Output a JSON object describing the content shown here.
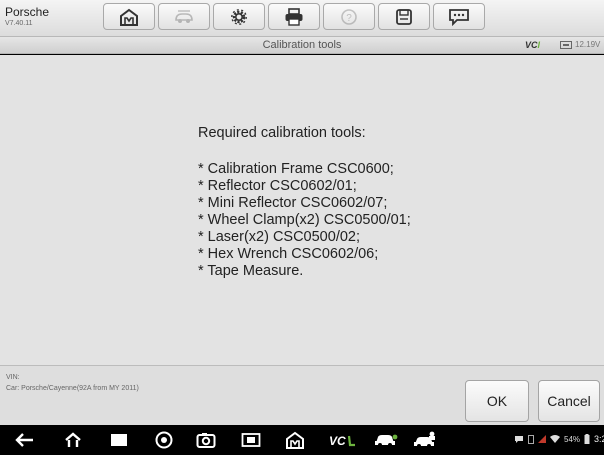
{
  "header": {
    "brand": "Porsche",
    "version": "V7.40.11"
  },
  "toolbar": {
    "buttons": [
      {
        "name": "home",
        "icon": "home-icon"
      },
      {
        "name": "vehicle-swap",
        "icon": "car-swap-icon"
      },
      {
        "name": "settings",
        "icon": "gear-icon"
      },
      {
        "name": "print",
        "icon": "printer-icon"
      },
      {
        "name": "help",
        "icon": "help-icon"
      },
      {
        "name": "save",
        "icon": "save-icon"
      },
      {
        "name": "data-logging",
        "icon": "chat-icon"
      }
    ]
  },
  "titlebar": {
    "title": "Calibration tools",
    "vci_label": "VCI",
    "voltage": "12.19V"
  },
  "message": {
    "heading": "Required calibration tools:",
    "items": [
      "* Calibration Frame CSC0600;",
      "* Reflector CSC0602/01;",
      "* Mini Reflector CSC0602/07;",
      "* Wheel Clamp(x2) CSC0500/01;",
      "* Laser(x2) CSC0500/02;",
      "* Hex Wrench CSC0602/06;",
      "* Tape Measure."
    ]
  },
  "footer": {
    "vin_label": "VIN:",
    "car_info": "Car: Porsche/Cayenne(92A from MY 2011)",
    "ok_label": "OK",
    "cancel_label": "Cancel"
  },
  "navbar": {
    "icons": [
      "back-icon",
      "home-icon",
      "recents-icon",
      "browser-icon",
      "camera-icon",
      "screenshot-icon",
      "app-home-icon",
      "vci-icon",
      "car-icon",
      "car-repair-icon"
    ],
    "battery_text": "54%",
    "time": "3:2"
  },
  "colors": {
    "content_bg": "#e3e3e3",
    "navbar_bg": "#000000",
    "vci_accent": "#6db33f"
  }
}
